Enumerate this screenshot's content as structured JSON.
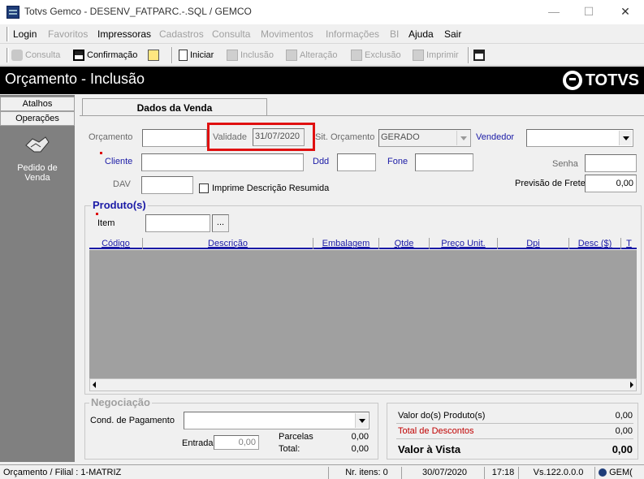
{
  "window": {
    "title": "Totvs Gemco - DESENV_FATPARC.-.SQL / GEMCO"
  },
  "menu": [
    "Login",
    "Favoritos",
    "Impressoras",
    "Cadastros",
    "Consulta",
    "Movimentos",
    "Informações",
    "BI",
    "Ajuda",
    "Sair"
  ],
  "toolbar": {
    "consulta": "Consulta",
    "confirmacao": "Confirmação",
    "iniciar": "Iniciar",
    "inclusao": "Inclusão",
    "alteracao": "Alteração",
    "exclusao": "Exclusão",
    "imprimir": "Imprimir"
  },
  "header": {
    "title": "Orçamento  - Inclusão",
    "logo": "TOTVS"
  },
  "sidebar": {
    "atalhos": "Atalhos",
    "operacoes": "Operações",
    "pedido": "Pedido de Venda"
  },
  "tab": {
    "label": "Dados da Venda"
  },
  "form": {
    "orcamento_label": "Orçamento",
    "orcamento_value": "",
    "validade_label": "Validade",
    "validade_value": "31/07/2020",
    "sit_label": "Sit. Orçamento",
    "sit_value": "GERADO",
    "vendedor_label": "Vendedor",
    "vendedor_value": "",
    "cliente_label": "Cliente",
    "ddd_label": "Ddd",
    "fone_label": "Fone",
    "senha_label": "Senha",
    "dav_label": "DAV",
    "imprime_label": "Imprime Descrição Resumida",
    "frete_label": "Previsão de Frete",
    "frete_value": "0,00"
  },
  "produtos": {
    "title": "Produto(s)",
    "item_label": "Item",
    "browse": "...",
    "columns": [
      "Código",
      "Descrição",
      "Embalagem",
      "Qtde",
      "Preço Unit.",
      "Dpi",
      "Desc ($)",
      "T"
    ]
  },
  "negociacao": {
    "title": "Negociação",
    "cond_label": "Cond. de Pagamento",
    "entrada_label": "Entrada",
    "entrada_value": "0,00",
    "parcelas_label": "Parcelas",
    "parcelas_value": "0,00",
    "total_label": "Total:",
    "total_value": "0,00"
  },
  "totais": {
    "produtos_label": "Valor do(s) Produto(s)",
    "produtos_value": "0,00",
    "descontos_label": "Total de Descontos",
    "descontos_value": "0,00",
    "vista_label": "Valor à Vista",
    "vista_value": "0,00"
  },
  "status": {
    "filial": "Orçamento / Filial : 1-MATRIZ",
    "itens": "Nr. itens: 0",
    "data": "30/07/2020",
    "hora": "17:18",
    "versao": "Vs.122.0.0.0",
    "user": "GEM("
  },
  "colors": {
    "accent": "#1a1aa6",
    "highlight": "#e01010",
    "header_bg": "#000000"
  }
}
